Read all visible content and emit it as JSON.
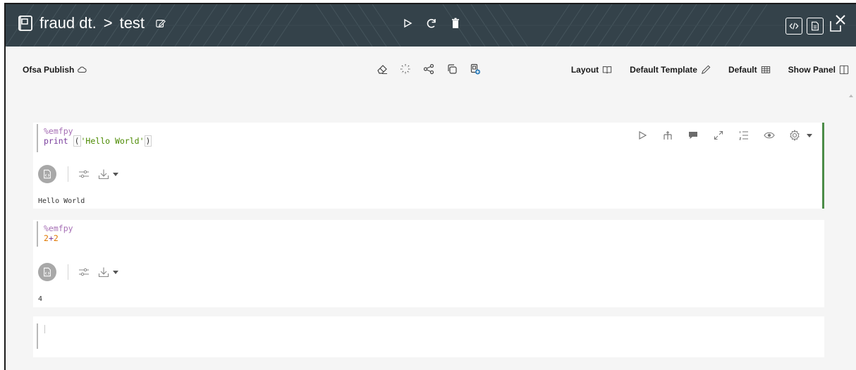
{
  "header": {
    "notebook_name": "fraud dt.",
    "separator": ">",
    "paragraph_name": "test",
    "bg_color": "#34424a",
    "icons": [
      "notebook-icon",
      "edit-icon",
      "run-icon",
      "refresh-icon",
      "delete-icon",
      "code-view-icon",
      "report-view-icon",
      "close-icon"
    ]
  },
  "toolbar": {
    "interpreter_label": "Ofsa Publish",
    "mid_icons": [
      "eraser-icon",
      "sparkle-icon",
      "share-icon",
      "copy-icon",
      "add-doc-icon"
    ],
    "layout_label": "Layout",
    "template_label": "Default Template",
    "default_label": "Default",
    "panel_label": "Show Panel"
  },
  "paragraphs": [
    {
      "code_magic": "%emfpy",
      "code_kw": "print",
      "code_open": "(",
      "code_str": "'Hello World'",
      "code_close": ")",
      "output": "Hello World",
      "accent": "#4c8c48"
    },
    {
      "code_magic": "%emfpy",
      "code_expr_a": "2",
      "code_op": "+",
      "code_expr_b": "2",
      "output": "4"
    },
    {
      "code": ""
    }
  ],
  "paragraph_tools": [
    "run-icon",
    "split-icon",
    "comments-icon",
    "expand-icon",
    "line-numbers-icon",
    "visibility-icon",
    "settings-icon"
  ]
}
